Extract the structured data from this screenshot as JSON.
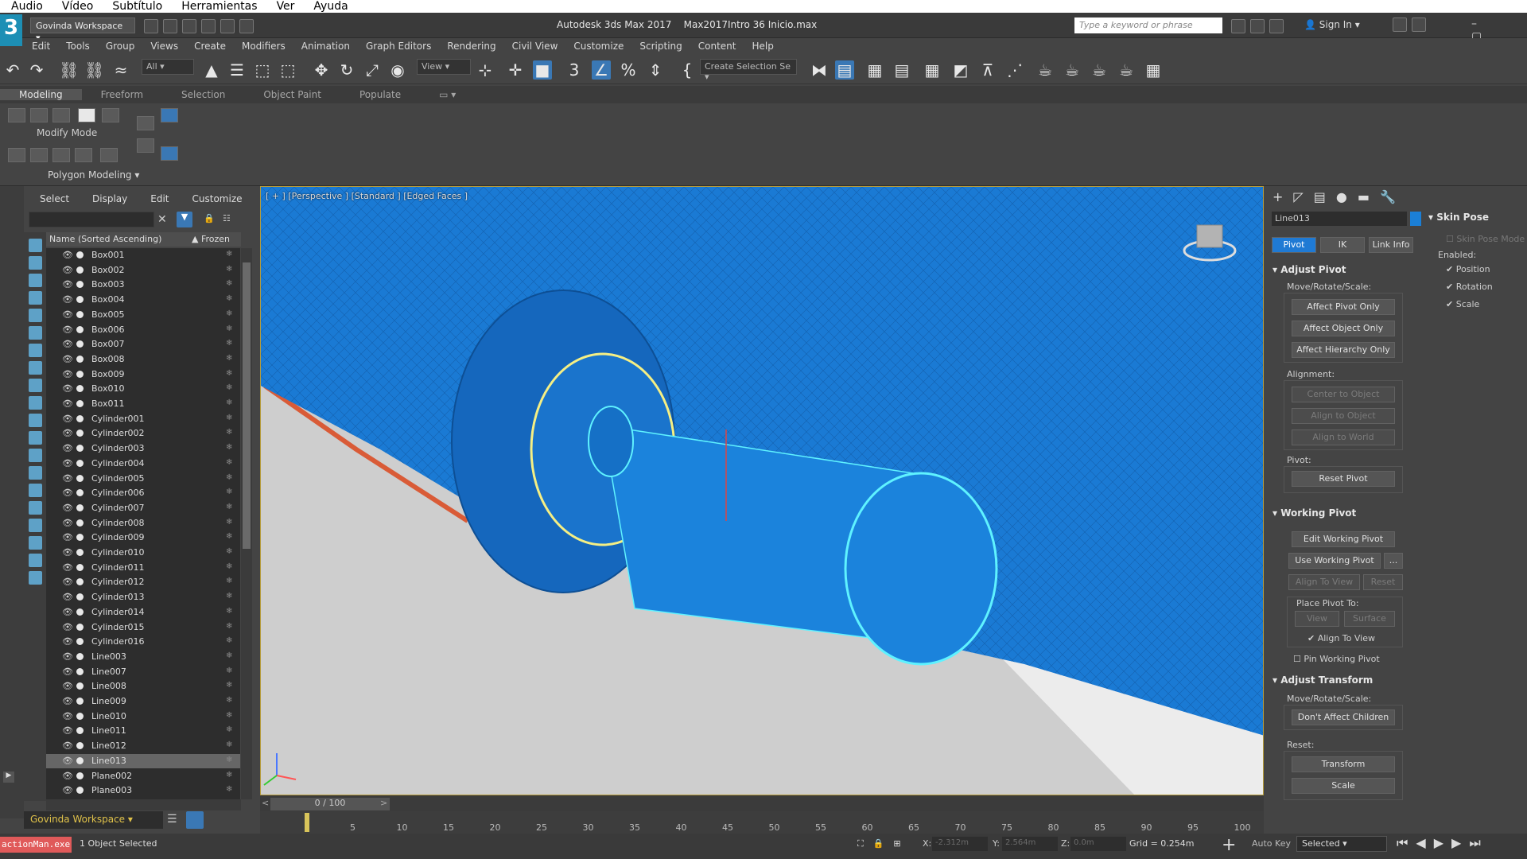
{
  "player_menu": [
    "Audio",
    "Vídeo",
    "Subtítulo",
    "Herramientas",
    "Ver",
    "Ayuda"
  ],
  "titlebar": {
    "workspace": "Govinda Workspace",
    "app_name": "Autodesk 3ds Max 2017",
    "file_name": "Max2017Intro 36 Inicio.max",
    "search_placeholder": "Type a keyword or phrase",
    "sign_in": "Sign In"
  },
  "menubar": [
    "Edit",
    "Tools",
    "Group",
    "Views",
    "Create",
    "Modifiers",
    "Animation",
    "Graph Editors",
    "Rendering",
    "Civil View",
    "Customize",
    "Scripting",
    "Content",
    "Help"
  ],
  "main_toolbar": {
    "filter_value": "All",
    "ref_coord_value": "View",
    "named_selection_value": "Create Selection Se"
  },
  "ribbon": {
    "tabs": [
      "Modeling",
      "Freeform",
      "Selection",
      "Object Paint",
      "Populate"
    ],
    "active_tab": "Modeling",
    "modify_mode": "Modify Mode",
    "polygon_modeling": "Polygon Modeling"
  },
  "scene_explorer": {
    "menu": [
      "Select",
      "Display",
      "Edit",
      "Customize"
    ],
    "col_name": "Name (Sorted Ascending)",
    "col_frozen": "▲ Frozen",
    "items": [
      "Box001",
      "Box002",
      "Box003",
      "Box004",
      "Box005",
      "Box006",
      "Box007",
      "Box008",
      "Box009",
      "Box010",
      "Box011",
      "Cylinder001",
      "Cylinder002",
      "Cylinder003",
      "Cylinder004",
      "Cylinder005",
      "Cylinder006",
      "Cylinder007",
      "Cylinder008",
      "Cylinder009",
      "Cylinder010",
      "Cylinder011",
      "Cylinder012",
      "Cylinder013",
      "Cylinder014",
      "Cylinder015",
      "Cylinder016",
      "Line003",
      "Line007",
      "Line008",
      "Line009",
      "Line010",
      "Line011",
      "Line012",
      "Line013",
      "Plane002",
      "Plane003"
    ],
    "selected": "Line013",
    "workspace": "Govinda Workspace"
  },
  "viewport": {
    "label": "[ + ] [Perspective ] [Standard ] [Edged Faces ]"
  },
  "command_panel": {
    "object_name": "Line013",
    "object_color": "#1b7fd6",
    "tabs": [
      "Pivot",
      "IK",
      "Link Info"
    ],
    "adjust_pivot": {
      "title": "Adjust Pivot",
      "move_label": "Move/Rotate/Scale:",
      "buttons": [
        "Affect Pivot Only",
        "Affect Object Only",
        "Affect Hierarchy Only"
      ],
      "alignment_label": "Alignment:",
      "align_buttons": [
        "Center to Object",
        "Align to Object",
        "Align to World"
      ],
      "pivot_label": "Pivot:",
      "reset_pivot": "Reset Pivot"
    },
    "working_pivot": {
      "title": "Working Pivot",
      "edit": "Edit Working Pivot",
      "use": "Use Working Pivot",
      "use_extra": "...",
      "align_to_view": "Align To View",
      "reset": "Reset",
      "place_label": "Place Pivot To:",
      "place_view": "View",
      "place_surface": "Surface",
      "align_check": "Align To View",
      "pin": "Pin Working Pivot"
    },
    "adjust_transform": {
      "title": "Adjust Transform",
      "move_label": "Move/Rotate/Scale:",
      "dont_affect": "Don't Affect Children",
      "reset_label": "Reset:",
      "transform": "Transform",
      "scale": "Scale"
    }
  },
  "skin_pose": {
    "title": "Skin Pose",
    "mode": "Skin Pose Mode",
    "enabled": "Enabled:",
    "position": "Position",
    "rotation": "Rotation",
    "scale": "Scale"
  },
  "timeline": {
    "position": "0 / 100",
    "ticks": [
      "5",
      "10",
      "15",
      "20",
      "25",
      "30",
      "35",
      "40",
      "45",
      "50",
      "55",
      "60",
      "65",
      "70",
      "75",
      "80",
      "85",
      "90",
      "95",
      "100"
    ]
  },
  "statusbar": {
    "listener": "actionMan.exe",
    "message": "1 Object Selected",
    "x_label": "X:",
    "x_value": "-2.312m",
    "y_label": "Y:",
    "y_value": "2.564m",
    "z_label": "Z:",
    "z_value": "0.0m",
    "grid": "Grid = 0.254m",
    "auto_key": "Auto Key",
    "key_mode": "Selected"
  }
}
